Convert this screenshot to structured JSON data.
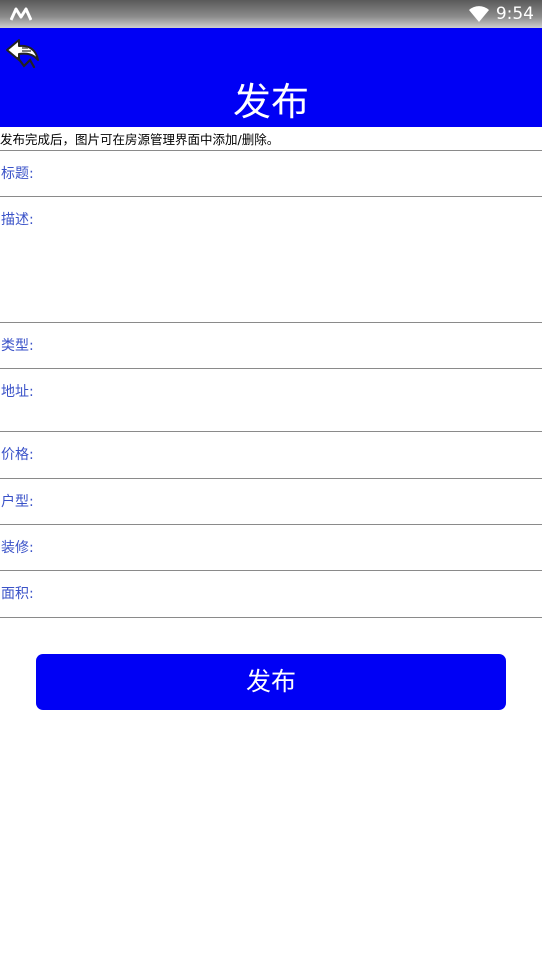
{
  "status_bar": {
    "time": "9:54",
    "icons": [
      "m-logo-icon",
      "wifi-icon"
    ]
  },
  "header": {
    "title": "发布",
    "back_icon": "back-arrow-icon",
    "background_color": "#0000f5"
  },
  "notice": "发布完成后，图片可在房源管理界面中添加/删除。",
  "form": {
    "fields": [
      {
        "key": "title",
        "label": "标题:",
        "value": ""
      },
      {
        "key": "description",
        "label": "描述:",
        "value": ""
      },
      {
        "key": "type",
        "label": "类型:",
        "value": ""
      },
      {
        "key": "address",
        "label": "地址:",
        "value": ""
      },
      {
        "key": "price",
        "label": "价格:",
        "value": ""
      },
      {
        "key": "layout",
        "label": "户型:",
        "value": ""
      },
      {
        "key": "decoration",
        "label": "装修:",
        "value": ""
      },
      {
        "key": "area",
        "label": "面积:",
        "value": ""
      }
    ]
  },
  "publish_button": {
    "label": "发布",
    "color": "#0000f5"
  },
  "colors": {
    "label_text": "#3a52c8",
    "divider": "#8a8a8a"
  }
}
